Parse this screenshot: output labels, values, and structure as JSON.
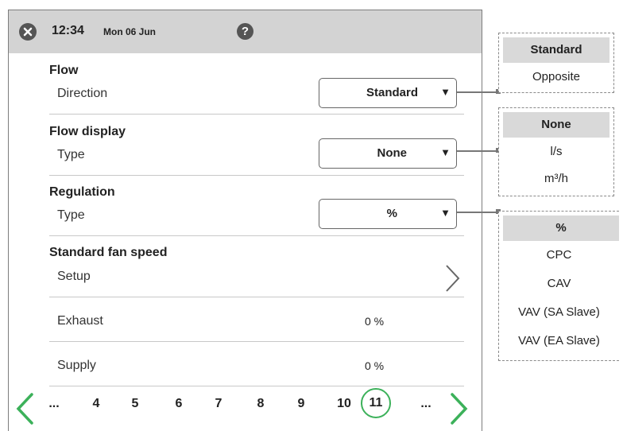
{
  "status_bar": {
    "time": "12:34",
    "date": "Mon 06 Jun",
    "close_icon": "close-icon",
    "help_label": "?"
  },
  "sections": {
    "flow": {
      "title": "Flow",
      "label": "Direction",
      "value": "Standard"
    },
    "flow_display": {
      "title": "Flow display",
      "label": "Type",
      "value": "None"
    },
    "regulation": {
      "title": "Regulation",
      "label": "Type",
      "value": "%"
    },
    "fan_speed": {
      "title": "Standard fan speed",
      "setup_label": "Setup",
      "exhaust_label": "Exhaust",
      "exhaust_value": "0 %",
      "supply_label": "Supply",
      "supply_value": "0 %"
    }
  },
  "pager": {
    "items": [
      "...",
      "4",
      "5",
      "6",
      "7",
      "8",
      "9",
      "10",
      "11",
      "..."
    ],
    "current": "11"
  },
  "legends": {
    "direction": {
      "header": "Standard",
      "options": [
        "Opposite"
      ]
    },
    "flow_display": {
      "header": "None",
      "options": [
        "l/s",
        "m³/h"
      ]
    },
    "regulation": {
      "header": "%",
      "options": [
        "CPC",
        "CAV",
        "VAV (SA Slave)",
        "VAV (EA Slave)"
      ]
    }
  },
  "colors": {
    "accent_green": "#3cb15a",
    "status_bar": "#d3d3d3",
    "icon_dark": "#555555"
  }
}
